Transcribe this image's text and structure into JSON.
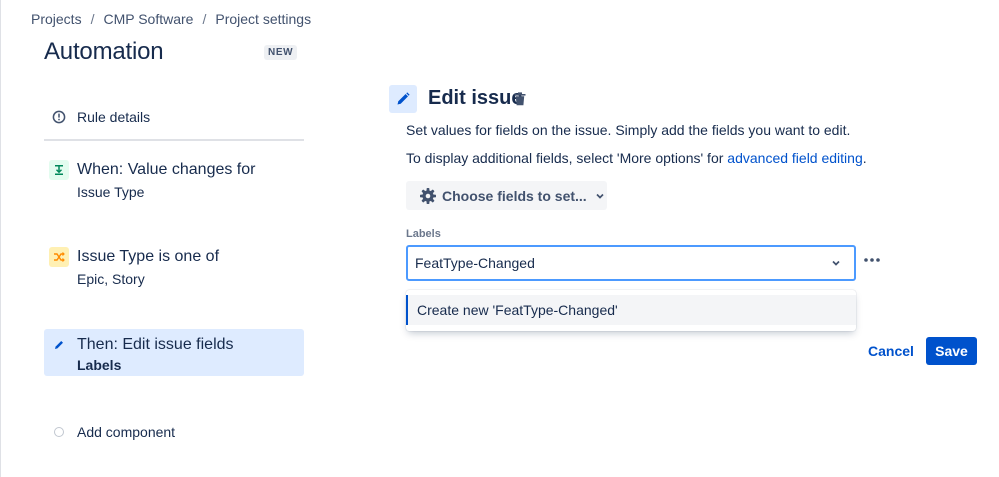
{
  "breadcrumb": [
    "Projects",
    "CMP Software",
    "Project settings"
  ],
  "breadcrumb_separator": "/",
  "page": {
    "title": "Automation",
    "badge": "NEW"
  },
  "sidebar": {
    "rule_details": "Rule details",
    "components": [
      {
        "title": "When: Value changes for",
        "subtitle": "Issue Type",
        "icon": "trigger-icon"
      },
      {
        "title": "Issue Type is one of",
        "subtitle": "Epic, Story",
        "icon": "condition-icon"
      },
      {
        "title": "Then: Edit issue fields",
        "subtitle": "Labels",
        "icon": "pencil-icon"
      }
    ],
    "add_component": "Add component"
  },
  "editor": {
    "title": "Edit issue",
    "description": "Set values for fields on the issue. Simply add the fields you want to edit.",
    "additional_prefix": "To display additional fields, select 'More options' for ",
    "additional_link": "advanced field editing",
    "additional_suffix": ".",
    "choose_fields_label": "Choose fields to set...",
    "labels_field": {
      "label": "Labels",
      "value": "FeatType-Changed",
      "dropdown_option": "Create new 'FeatType-Changed'"
    },
    "cancel_label": "Cancel",
    "save_label": "Save"
  },
  "colors": {
    "accent": "#0052cc",
    "selected_bg": "#deebff",
    "focus_border": "#4c9aff",
    "trigger_bg": "#e3fcef",
    "condition_bg": "#fff0b3"
  }
}
